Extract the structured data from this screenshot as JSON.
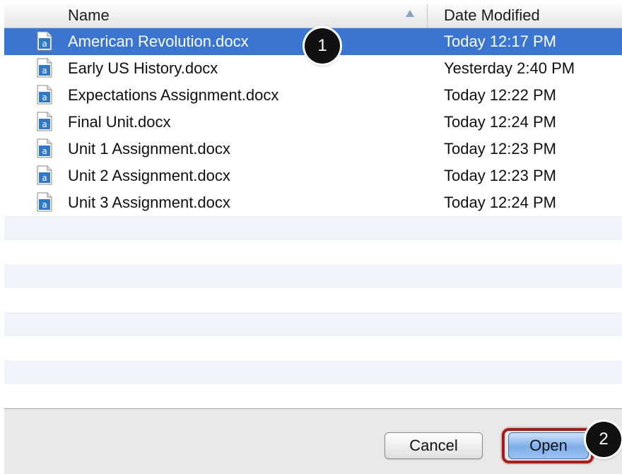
{
  "columns": {
    "name_label": "Name",
    "date_label": "Date Modified"
  },
  "files": [
    {
      "name": "American Revolution.docx",
      "date": "Today 12:17 PM",
      "selected": true
    },
    {
      "name": "Early US History.docx",
      "date": "Yesterday 2:40 PM",
      "selected": false
    },
    {
      "name": "Expectations Assignment.docx",
      "date": "Today 12:22 PM",
      "selected": false
    },
    {
      "name": "Final Unit.docx",
      "date": "Today 12:24 PM",
      "selected": false
    },
    {
      "name": "Unit 1 Assignment.docx",
      "date": "Today 12:23 PM",
      "selected": false
    },
    {
      "name": "Unit 2 Assignment.docx",
      "date": "Today 12:23 PM",
      "selected": false
    },
    {
      "name": "Unit 3 Assignment.docx",
      "date": "Today 12:24 PM",
      "selected": false
    }
  ],
  "buttons": {
    "cancel_label": "Cancel",
    "open_label": "Open"
  },
  "callouts": [
    "1",
    "2"
  ],
  "icons": {
    "file": "document-file-icon",
    "sort": "sort-ascending-icon"
  },
  "colors": {
    "selection": "#3a76d0",
    "stripe": "#eff3fa",
    "highlight_ring": "#a51c1c",
    "open_button": "#7eaeea"
  }
}
